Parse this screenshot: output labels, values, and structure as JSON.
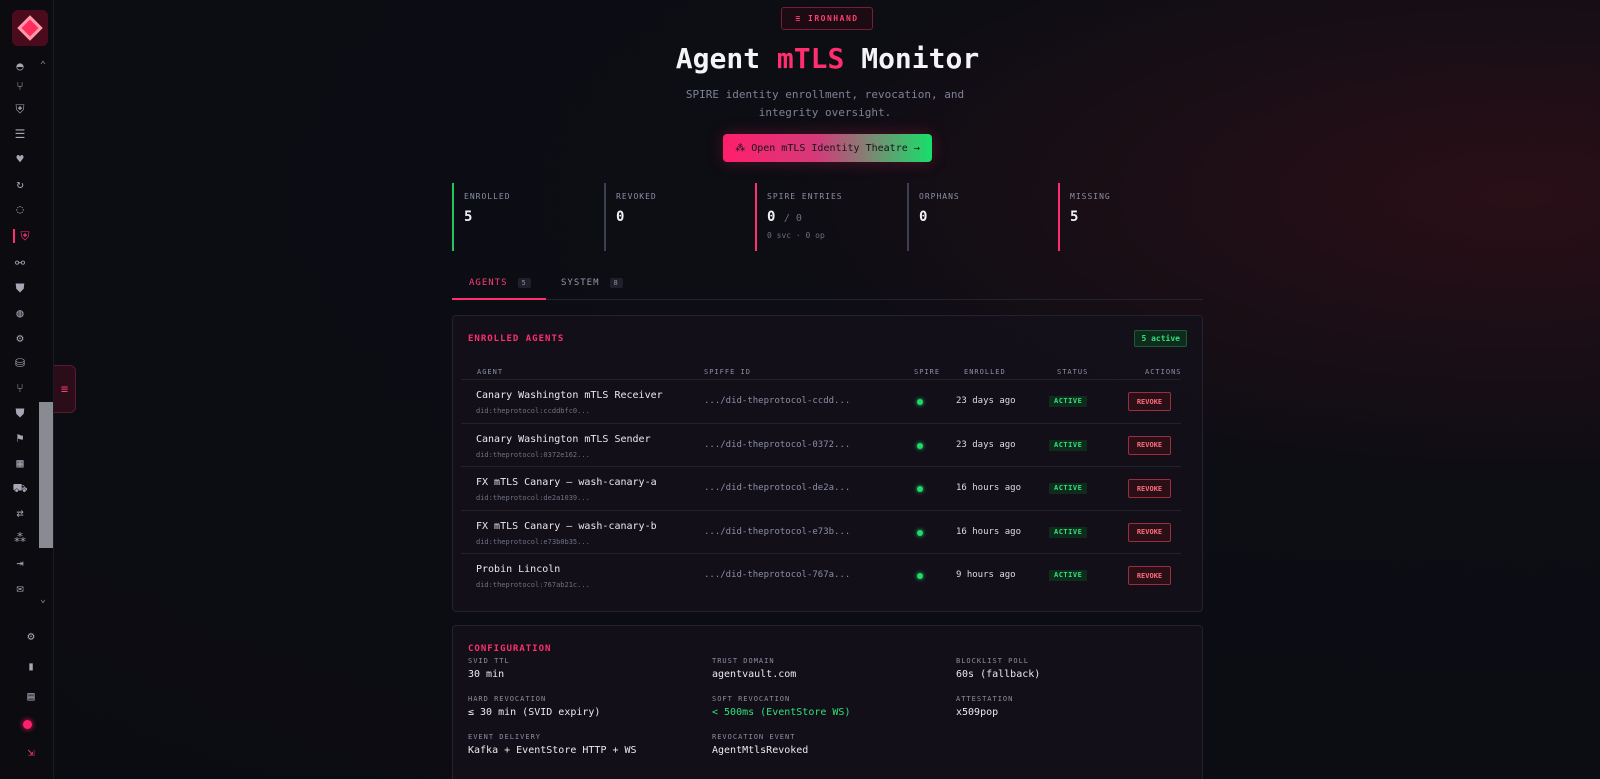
{
  "sidebar": {
    "icons": [
      "home-icon",
      "branch-icon",
      "shield-icon",
      "server-icon",
      "heartbeat-icon",
      "refresh-icon",
      "chat-icon",
      "mtls-shield-icon",
      "workflow-icon",
      "shield-check-icon",
      "globe-icon",
      "gear-shield-icon",
      "database-icon",
      "branch2-icon",
      "shield2-icon",
      "flag-icon",
      "table-icon",
      "truck-icon",
      "swap-icon",
      "cluster-icon",
      "export-icon",
      "mail-icon"
    ],
    "bottom": [
      "settings-icon",
      "book-icon",
      "terminal-icon"
    ]
  },
  "header": {
    "badge": "≡ IRONHAND",
    "title_pre": "Agent ",
    "title_accent": "mTLS",
    "title_post": " Monitor",
    "subtitle": "SPIRE identity enrollment, revocation, and integrity oversight.",
    "cta": "Open mTLS Identity Theatre →"
  },
  "stats": [
    {
      "label": "ENROLLED",
      "value": "5",
      "color": "#22c55e"
    },
    {
      "label": "REVOKED",
      "value": "0",
      "color": "#3a3f52"
    },
    {
      "label": "SPIRE ENTRIES",
      "value": "0",
      "sub": "/ 0",
      "note": "0 svc · 0 op",
      "color": "#ff2e6e"
    },
    {
      "label": "ORPHANS",
      "value": "0",
      "color": "#3a3f52"
    },
    {
      "label": "MISSING",
      "value": "5",
      "color": "#ff2e6e"
    }
  ],
  "tabs": [
    {
      "label": "AGENTS",
      "count": "5"
    },
    {
      "label": "SYSTEM",
      "count": "8"
    }
  ],
  "agents_panel": {
    "title": "ENROLLED AGENTS",
    "active_badge": "5 active",
    "headers": [
      "AGENT",
      "SPIFFE ID",
      "SPIRE",
      "ENROLLED",
      "STATUS",
      "ACTIONS"
    ],
    "rows": [
      {
        "name": "Canary Washington mTLS Receiver",
        "did": "did:theprotocol:ccddbfc0...",
        "spiffe": ".../did-theprotocol-ccdd...",
        "enrolled": "23 days ago",
        "status": "ACTIVE",
        "action": "REVOKE"
      },
      {
        "name": "Canary Washington mTLS Sender",
        "did": "did:theprotocol:0372e162...",
        "spiffe": ".../did-theprotocol-0372...",
        "enrolled": "23 days ago",
        "status": "ACTIVE",
        "action": "REVOKE"
      },
      {
        "name": "FX mTLS Canary — wash-canary-a",
        "did": "did:theprotocol:de2a1039...",
        "spiffe": ".../did-theprotocol-de2a...",
        "enrolled": "16 hours ago",
        "status": "ACTIVE",
        "action": "REVOKE"
      },
      {
        "name": "FX mTLS Canary — wash-canary-b",
        "did": "did:theprotocol:e73b0b35...",
        "spiffe": ".../did-theprotocol-e73b...",
        "enrolled": "16 hours ago",
        "status": "ACTIVE",
        "action": "REVOKE"
      },
      {
        "name": "Probin Lincoln",
        "did": "did:theprotocol:767ab21c...",
        "spiffe": ".../did-theprotocol-767a...",
        "enrolled": "9 hours ago",
        "status": "ACTIVE",
        "action": "REVOKE"
      }
    ]
  },
  "config": {
    "title": "CONFIGURATION",
    "items": [
      {
        "label": "SVID TTL",
        "value": "30 min"
      },
      {
        "label": "TRUST DOMAIN",
        "value": "agentvault.com"
      },
      {
        "label": "BLOCKLIST POLL",
        "value": "60s (fallback)"
      },
      {
        "label": "HARD REVOCATION",
        "value": "≤ 30 min (SVID expiry)"
      },
      {
        "label": "SOFT REVOCATION",
        "value": "< 500ms (EventStore WS)",
        "highlight": true
      },
      {
        "label": "ATTESTATION",
        "value": "x509pop"
      },
      {
        "label": "EVENT DELIVERY",
        "value": "Kafka + EventStore HTTP + WS"
      },
      {
        "label": "REVOCATION EVENT",
        "value": "AgentMtlsRevoked"
      }
    ]
  }
}
